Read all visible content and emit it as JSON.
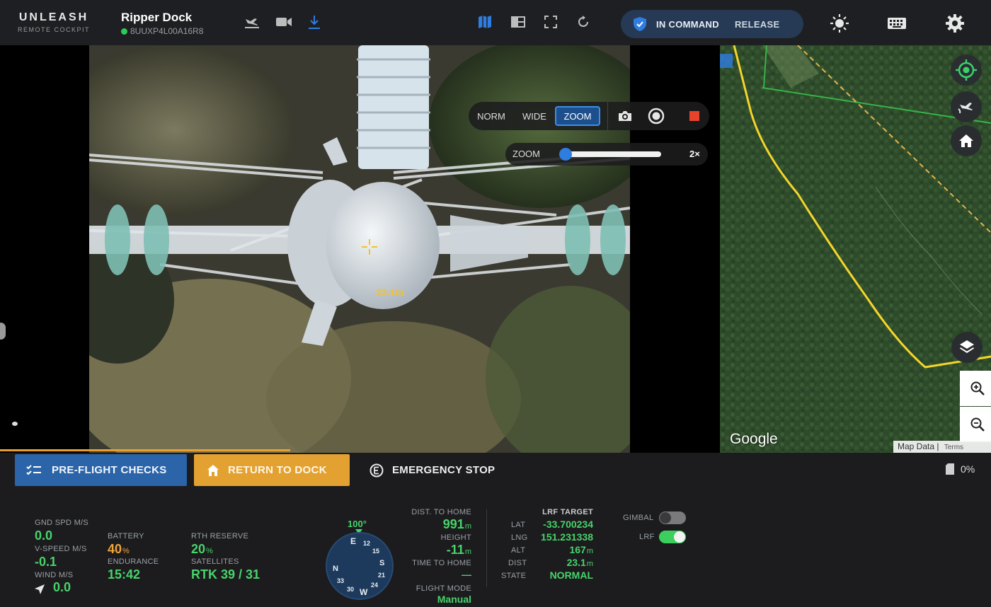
{
  "app": {
    "logo_line1": "UNLEASH",
    "logo_line2": "REMOTE COCKPIT",
    "dock_name": "Ripper Dock",
    "dock_serial": "8UUXP4L00A16R8"
  },
  "topbar": {
    "icons": [
      "landing-icon",
      "video-camera-icon",
      "download-icon",
      "map-view-icon",
      "split-view-icon",
      "fullscreen-icon",
      "refresh-icon",
      "brightness-icon",
      "keyboard-icon",
      "settings-icon"
    ],
    "in_command": "IN COMMAND",
    "release": "RELEASE"
  },
  "video": {
    "lens_modes": [
      "NORM",
      "WIDE",
      "ZOOM"
    ],
    "active_lens": "ZOOM",
    "zoom_label": "ZOOM",
    "zoom_value": "2×",
    "zoom_level": 0.05,
    "lrf_readout": "23.1m"
  },
  "map": {
    "google_label": "Google",
    "map_data": "Map Data",
    "terms": "Terms"
  },
  "actions": {
    "preflight": "PRE-FLIGHT CHECKS",
    "return_to_dock": "RETURN TO DOCK",
    "emergency_stop": "EMERGENCY STOP",
    "storage": "0%"
  },
  "telemetry": {
    "gnd_spd_label": "GND SPD M/S",
    "gnd_spd_value": "0.0",
    "vspeed_label": "V-SPEED M/S",
    "vspeed_value": "-0.1",
    "wind_label": "WIND M/S",
    "wind_value": "0.0",
    "battery_label": "BATTERY",
    "battery_value": "40",
    "battery_unit": "%",
    "endurance_label": "ENDURANCE",
    "endurance_value": "15:42",
    "rth_label": "RTH RESERVE",
    "rth_value": "20",
    "rth_unit": "%",
    "satellites_label": "SATELLITES",
    "satellites_value": "RTK 39 / 31",
    "heading": "100°",
    "compass_labels": [
      "E",
      "12",
      "15",
      "S",
      "21",
      "24",
      "W",
      "30",
      "33",
      "N"
    ],
    "dist_home_label": "DIST. TO HOME",
    "dist_home_value": "991",
    "dist_home_unit": "m",
    "height_label": "HEIGHT",
    "height_value": "-11",
    "height_unit": "m",
    "time_home_label": "TIME TO HOME",
    "time_home_value": "—",
    "flight_mode_label": "FLIGHT MODE",
    "flight_mode_value": "Manual",
    "lrf_title": "LRF TARGET",
    "lat_label": "LAT",
    "lat_value": "-33.700234",
    "lng_label": "LNG",
    "lng_value": "151.231338",
    "alt_label": "ALT",
    "alt_value": "167",
    "alt_unit": "m",
    "dist_label": "DIST",
    "dist_value": "23.1",
    "dist_unit": "m",
    "state_label": "STATE",
    "state_value": "NORMAL",
    "gimbal_label": "GIMBAL",
    "gimbal_on": false,
    "lrf_label": "LRF",
    "lrf_on": true
  },
  "colors": {
    "accent_green": "#48d36b",
    "battery_orange": "#f0a53a",
    "preflight_blue": "#2b64a8",
    "return_orange": "#e3a131",
    "command_pill": "#263a55",
    "map_boundary_yellow": "#f5d52b"
  }
}
